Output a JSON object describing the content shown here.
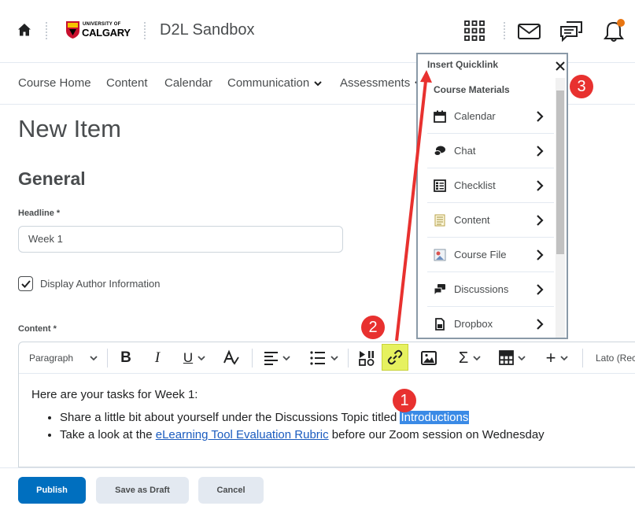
{
  "header": {
    "logo_small": "UNIVERSITY OF",
    "logo_large": "CALGARY",
    "site_title": "D2L Sandbox"
  },
  "nav": {
    "items": [
      {
        "label": "Course Home"
      },
      {
        "label": "Content"
      },
      {
        "label": "Calendar"
      },
      {
        "label": "Communication"
      },
      {
        "label": "Assessments"
      }
    ]
  },
  "page": {
    "title": "New Item",
    "section_title": "General",
    "headline_label": "Headline *",
    "headline_value": "Week 1",
    "display_author_label": "Display Author Information",
    "display_author_checked": true,
    "content_label": "Content *"
  },
  "editor": {
    "paragraph_label": "Paragraph",
    "font_label": "Lato (Rec",
    "intro": "Here are your tasks for Week 1:",
    "bullet1_before": "Share a little bit about yourself under the Discussions Topic titled ",
    "bullet1_selected": "Introductions",
    "bullet2_before": "Take a look at the ",
    "bullet2_link": "eLearning Tool Evaluation Rubric",
    "bullet2_after": " before our Zoom session on Wednesday"
  },
  "footer": {
    "publish": "Publish",
    "save_draft": "Save as Draft",
    "cancel": "Cancel"
  },
  "quicklink": {
    "title": "Insert Quicklink",
    "subtitle": "Course Materials",
    "items": [
      {
        "label": "Calendar",
        "icon": "calendar-icon"
      },
      {
        "label": "Chat",
        "icon": "chat-icon"
      },
      {
        "label": "Checklist",
        "icon": "checklist-icon"
      },
      {
        "label": "Content",
        "icon": "content-icon"
      },
      {
        "label": "Course File",
        "icon": "course-file-icon"
      },
      {
        "label": "Discussions",
        "icon": "discussions-icon"
      },
      {
        "label": "Dropbox",
        "icon": "dropbox-icon"
      }
    ]
  },
  "annotations": {
    "step1": "1",
    "step2": "2",
    "step3": "3"
  },
  "colors": {
    "primary": "#006fbf",
    "annotation": "#e8312f",
    "highlight": "#e6f15f",
    "selection": "#3a8ae6",
    "notification": "#e87511"
  }
}
